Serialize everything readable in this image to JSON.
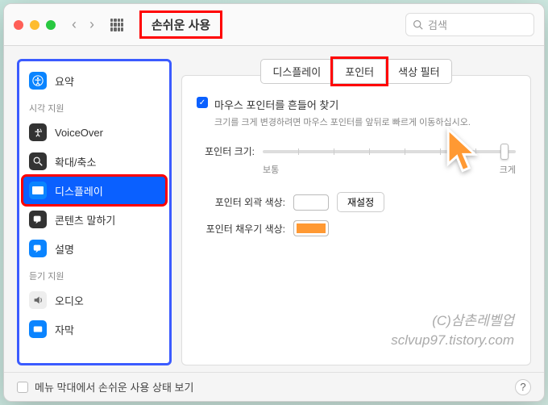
{
  "window": {
    "title": "손쉬운 사용",
    "search_placeholder": "검색"
  },
  "sidebar": {
    "summary": "요약",
    "section_visual": "시각 지원",
    "section_hearing": "듣기 지원",
    "items": {
      "voiceover": "VoiceOver",
      "zoom": "확대/축소",
      "display": "디스플레이",
      "speak": "콘텐츠 말하기",
      "desc": "설명",
      "audio": "오디오",
      "caption": "자막"
    }
  },
  "tabs": {
    "display": "디스플레이",
    "pointer": "포인터",
    "color_filter": "색상 필터"
  },
  "panel": {
    "shake_label": "마우스 포인터를 흔들어 찾기",
    "shake_hint": "크기를 크게 변경하려면 마우스 포인터를 앞뒤로 빠르게 이동하십시오.",
    "size_label": "포인터 크기:",
    "size_min": "보통",
    "size_max": "크게",
    "outline_label": "포인터 외곽 색상:",
    "fill_label": "포인터 채우기 색상:",
    "reset": "재설정",
    "colors": {
      "outline": "#ffffff",
      "fill": "#ff9933"
    }
  },
  "footer": {
    "menubar_label": "메뉴 막대에서 손쉬운 사용 상태 보기"
  },
  "watermark": {
    "line1": "(C)삼촌레벨업",
    "line2": "sclvup97.tistory.com"
  }
}
